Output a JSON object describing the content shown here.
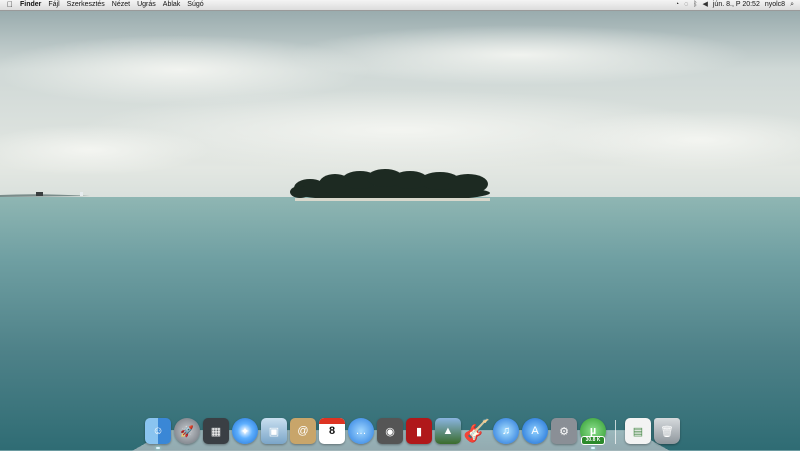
{
  "menubar": {
    "apple_icon": "apple-logo-icon",
    "app_name": "Finder",
    "items": [
      "Fájl",
      "Szerkesztés",
      "Nézet",
      "Ugrás",
      "Ablak",
      "Súgó"
    ],
    "status_icons": [
      "time-machine-icon",
      "sync-icon",
      "bluetooth-icon",
      "volume-icon"
    ],
    "datetime": "jún. 8., P 20:52",
    "user": "nyolc8",
    "search_icon": "spotlight-search-icon"
  },
  "dock": {
    "apps": [
      {
        "name": "finder",
        "icon": "finder-icon",
        "glyph": "☺",
        "running": true
      },
      {
        "name": "launchpad",
        "icon": "launchpad-rocket-icon",
        "glyph": "🚀",
        "running": false
      },
      {
        "name": "dashboard",
        "icon": "dashboard-icon",
        "glyph": "▦",
        "running": false
      },
      {
        "name": "safari",
        "icon": "safari-compass-icon",
        "glyph": "✦",
        "running": false
      },
      {
        "name": "preview",
        "icon": "preview-icon",
        "glyph": "▣",
        "running": false
      },
      {
        "name": "contacts",
        "icon": "address-book-icon",
        "glyph": "@",
        "running": false
      },
      {
        "name": "calendar",
        "icon": "calendar-icon",
        "glyph": "8",
        "running": false
      },
      {
        "name": "ichat",
        "icon": "ichat-bubble-icon",
        "glyph": "…",
        "running": false
      },
      {
        "name": "facetime",
        "icon": "facetime-camera-icon",
        "glyph": "◉",
        "running": false
      },
      {
        "name": "photobooth",
        "icon": "photo-booth-icon",
        "glyph": "▮",
        "running": false
      },
      {
        "name": "iphoto",
        "icon": "iphoto-icon",
        "glyph": "▲",
        "running": false
      },
      {
        "name": "garageband",
        "icon": "garageband-guitar-icon",
        "glyph": "🎸",
        "running": false
      },
      {
        "name": "itunes",
        "icon": "itunes-note-icon",
        "glyph": "♫",
        "running": false
      },
      {
        "name": "appstore",
        "icon": "app-store-icon",
        "glyph": "A",
        "running": false
      },
      {
        "name": "sysprefs",
        "icon": "system-preferences-gear-icon",
        "glyph": "⚙",
        "running": false
      },
      {
        "name": "utorrent",
        "icon": "utorrent-icon",
        "glyph": "µ",
        "badge": "30.8 K",
        "running": true
      }
    ],
    "others": [
      {
        "name": "document",
        "icon": "document-stack-icon",
        "glyph": "▤"
      },
      {
        "name": "trash",
        "icon": "trash-icon",
        "glyph": "🗑"
      }
    ]
  }
}
